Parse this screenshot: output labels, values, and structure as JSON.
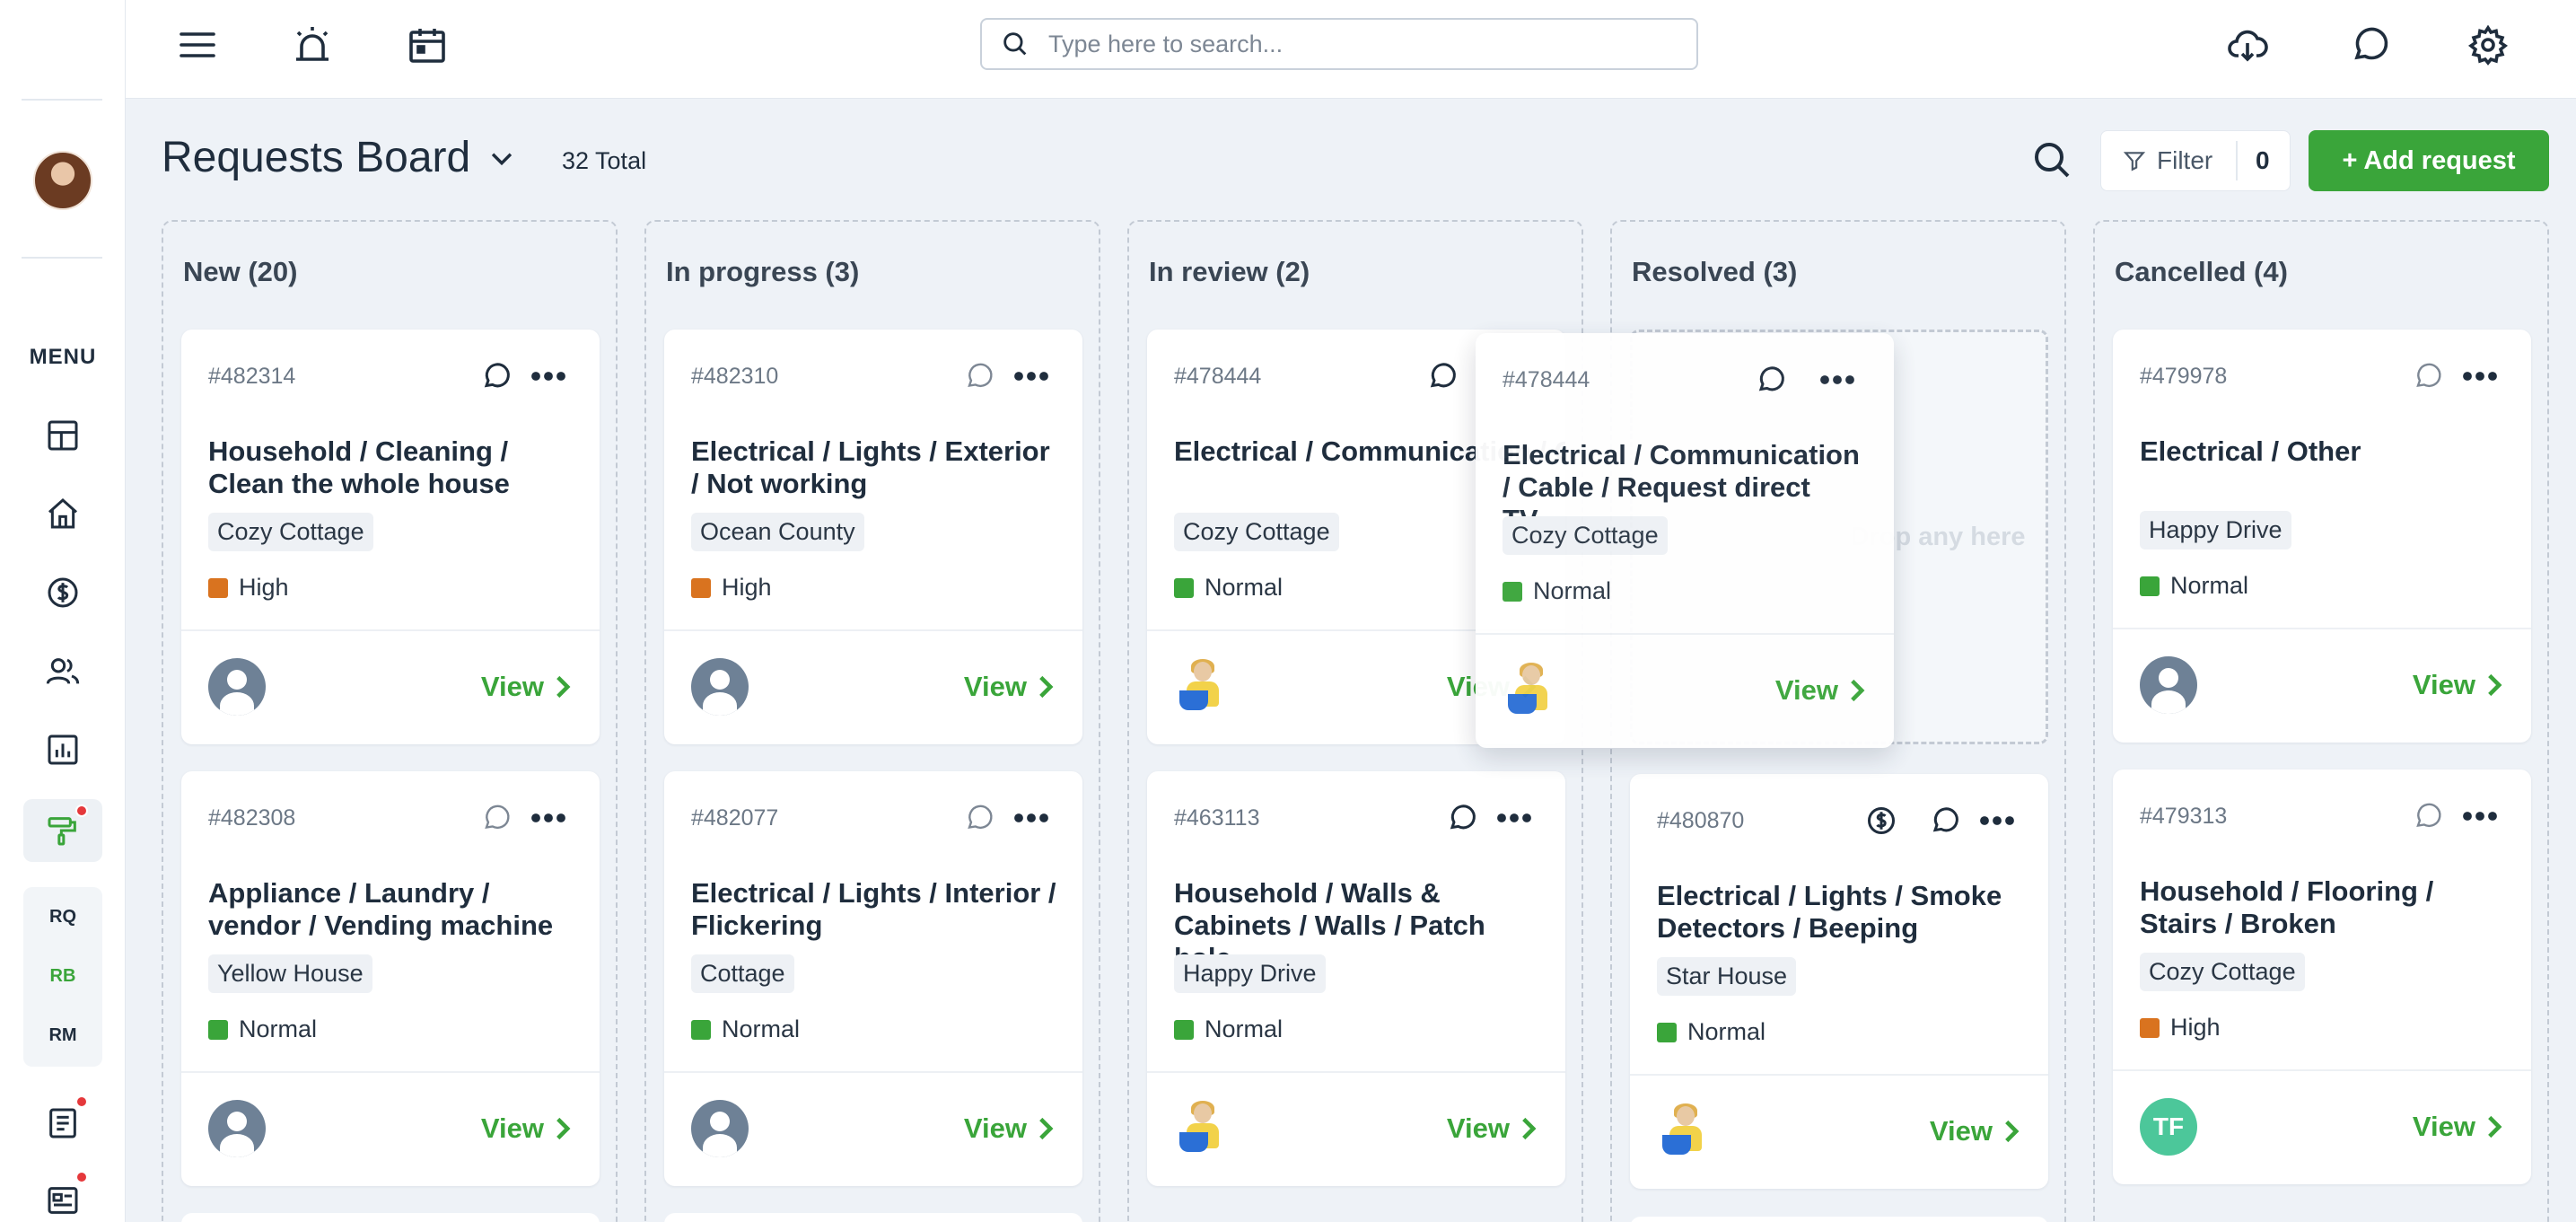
{
  "topbar": {
    "search_placeholder": "Type here to search..."
  },
  "sidebar": {
    "menu_label": "MENU",
    "subnav": [
      "RQ",
      "RB",
      "RM"
    ],
    "current_subnav": "RB"
  },
  "board": {
    "title": "Requests Board",
    "total": "32 Total",
    "filter_label": "Filter",
    "filter_count": "0",
    "add_label": "+ Add request"
  },
  "columns": [
    {
      "title": "New (20)",
      "cards": [
        {
          "id": "#482314",
          "title": "Household / Cleaning / Clean the whole house",
          "property": "Cozy Cottage",
          "priority": "High",
          "assignee": "default",
          "view": "View"
        },
        {
          "id": "#482308",
          "title": "Appliance / Laundry / vendor / Vending machine ...",
          "property": "Yellow House",
          "priority": "Normal",
          "assignee": "default",
          "view": "View"
        }
      ]
    },
    {
      "title": "In progress (3)",
      "cards": [
        {
          "id": "#482310",
          "title": "Electrical / Lights / Exterior / Not working",
          "property": "Ocean County",
          "priority": "High",
          "assignee": "default",
          "view": "View"
        },
        {
          "id": "#482077",
          "title": "Electrical / Lights / Interior / Flickering",
          "property": "Cottage",
          "priority": "Normal",
          "assignee": "default",
          "view": "View"
        }
      ]
    },
    {
      "title": "In review (2)",
      "cards": [
        {
          "id": "#478444",
          "title": "Electrical / Communication / Cable / Request direct TV",
          "property": "Cozy Cottage",
          "priority": "Normal",
          "assignee": "person",
          "view": "View"
        },
        {
          "id": "#463113",
          "title": "Household / Walls & Cabinets / Walls / Patch hole",
          "property": "Happy Drive",
          "priority": "Normal",
          "assignee": "person",
          "view": "View"
        }
      ]
    },
    {
      "title": "Resolved (3)",
      "drop_text": "Drop any here",
      "cards": [
        {
          "id": "#480870",
          "title": "Electrical / Lights / Smoke Detectors / Beeping",
          "property": "Star House",
          "priority": "Normal",
          "assignee": "person",
          "view": "View"
        }
      ]
    },
    {
      "title": "Cancelled (4)",
      "cards": [
        {
          "id": "#479978",
          "title": "Electrical / Other",
          "property": "Happy Drive",
          "priority": "Normal",
          "assignee": "default",
          "view": "View"
        },
        {
          "id": "#479313",
          "title": "Household / Flooring / Stairs / Broken",
          "property": "Cozy Cottage",
          "priority": "High",
          "assignee": "TF",
          "view": "View"
        }
      ]
    }
  ],
  "dragging_card": {
    "id": "#478444",
    "title": "Electrical / Communication / Cable / Request direct TV...",
    "property": "Cozy Cottage",
    "priority": "Normal",
    "assignee": "person",
    "view": "View"
  },
  "colors": {
    "accent": "#3aa53a",
    "high": "#d9731f",
    "normal": "#3aa53a",
    "notification": "#e5383b"
  },
  "icons": [
    "menu-icon",
    "alarm-icon",
    "calendar-icon",
    "search-icon",
    "cloud-download-icon",
    "chat-icon",
    "gear-icon",
    "dashboard-icon",
    "home-icon",
    "dollar-icon",
    "users-icon",
    "chart-icon",
    "paint-roller-icon",
    "document-icon",
    "news-icon",
    "filter-icon",
    "chevron-down-icon",
    "chevron-right-icon",
    "more-icon"
  ]
}
